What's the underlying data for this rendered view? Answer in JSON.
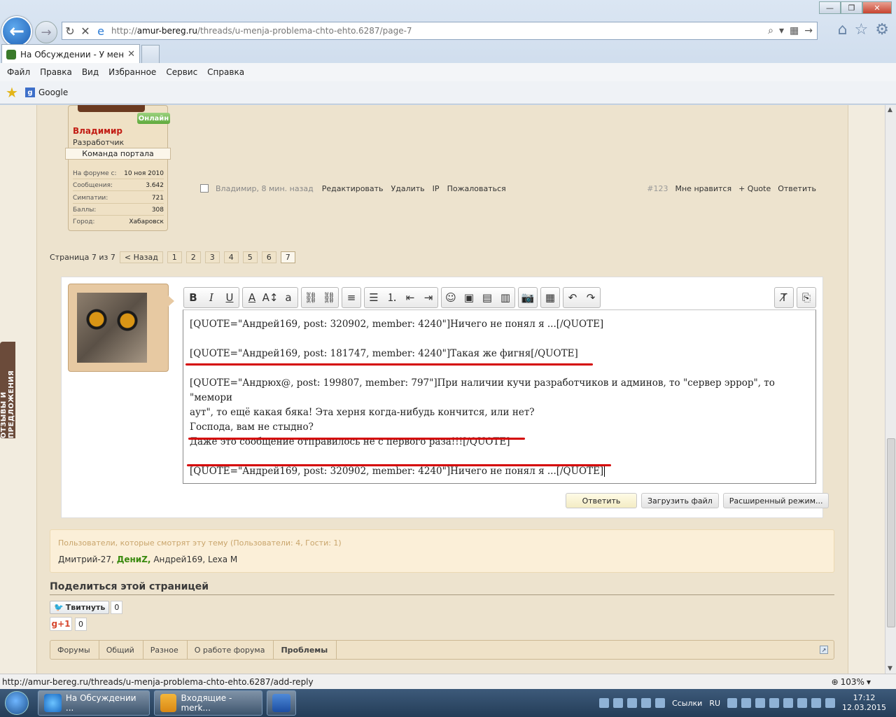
{
  "browser": {
    "url_prefix": "http://",
    "url_host": "amur-bereg.ru",
    "url_path": "/threads/u-menja-problema-chto-ehto.6287/page-7",
    "tab_title": "На Обсуждении - У меня ...",
    "menu": [
      "Файл",
      "Правка",
      "Вид",
      "Избранное",
      "Сервис",
      "Справка"
    ],
    "favorites": [
      "Google"
    ]
  },
  "post": {
    "online": "Онлайн",
    "user_name": "Владимир",
    "user_role": "Разработчик",
    "user_team": "Команда портала",
    "stats": [
      {
        "label": "На форуме с:",
        "value": "10 ноя 2010"
      },
      {
        "label": "Сообщения:",
        "value": "3.642"
      },
      {
        "label": "Симпатии:",
        "value": "721"
      },
      {
        "label": "Баллы:",
        "value": "308"
      },
      {
        "label": "Город:",
        "value": "Хабаровск"
      }
    ],
    "meta": "Владимир, 8 мин. назад",
    "actions": [
      "Редактировать",
      "Удалить",
      "IP",
      "Пожаловаться"
    ],
    "number": "#123",
    "like": "Мне нравится",
    "quote": "+ Quote",
    "reply": "Ответить"
  },
  "pager": {
    "label": "Страница 7 из 7",
    "prev": "< Назад",
    "pages": [
      "1",
      "2",
      "3",
      "4",
      "5",
      "6",
      "7"
    ],
    "current": "7"
  },
  "editor": {
    "line1": "[QUOTE=\"Андрей169, post: 320902, member: 4240\"]Ничего не понял я ...[/QUOTE]",
    "line2": "[QUOTE=\"Андрей169, post: 181747, member: 4240\"]Такая же фигня[/QUOTE]",
    "line3a": "[QUOTE=\"Андрюх@, post: 199807, member: 797\"]При наличии кучи разработчиков и админов, то \"сервер эррор\", то \"мемори",
    "line3b": "аут\", то ещё какая бяка! Эта херня когда-нибудь кончится, или нет?",
    "line3c": "Господа, вам не стыдно?",
    "line3d": "Даже это сообщение отправилось не с первого раза!!![/QUOTE]",
    "line4": "[QUOTE=\"Андрей169, post: 320902, member: 4240\"]Ничего не понял я ...[/QUOTE]",
    "submit": "Ответить",
    "upload": "Загрузить файл",
    "advanced": "Расширенный режим..."
  },
  "viewers": {
    "title": "Пользователи, которые смотрят эту тему (Пользователи: 4, Гости: 1)",
    "u1": "Дмитрий-27,",
    "u2": "ДениZ,",
    "u3": "Андрей169,",
    "u4": "Lexa M"
  },
  "share": {
    "title": "Поделиться этой страницей",
    "tweet": "Твитнуть",
    "tweet_count": "0",
    "gplus": "g+1",
    "gplus_count": "0"
  },
  "breadcrumbs": [
    "Форумы",
    "Общий",
    "Разное",
    "О работе форума",
    "Проблемы"
  ],
  "feedback_tab": "ОТЗЫВЫ И ПРЕДЛОЖЕНИЯ",
  "statusbar": {
    "url": "http://amur-bereg.ru/threads/u-menja-problema-chto-ehto.6287/add-reply",
    "zoom": "103%"
  },
  "taskbar": {
    "task1": "На Обсуждении ...",
    "task2": "Входящие - merk...",
    "links": "Ссылки",
    "lang": "RU",
    "time": "17:12",
    "date": "12.03.2015"
  },
  "colors": {
    "accent_red": "#d40000",
    "username_red": "#c21d14",
    "online_green": "#5ea93c"
  }
}
